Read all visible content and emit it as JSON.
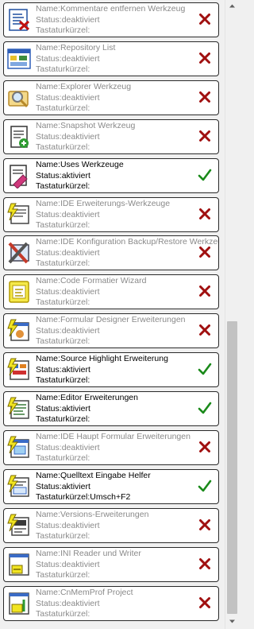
{
  "labels": {
    "name": "Name:",
    "status": "Status:",
    "shortcut": "Tastaturkürzel:"
  },
  "items": [
    {
      "name": "Kommentare entfernen Werkzeug",
      "status": "deaktiviert",
      "shortcut": "",
      "active": false,
      "icon": "comment-remove-icon"
    },
    {
      "name": "Repository List",
      "status": "deaktiviert",
      "shortcut": "",
      "active": false,
      "icon": "repository-list-icon"
    },
    {
      "name": "Explorer Werkzeug",
      "status": "deaktiviert",
      "shortcut": "",
      "active": false,
      "icon": "explorer-icon"
    },
    {
      "name": "Snapshot Werkzeug",
      "status": "deaktiviert",
      "shortcut": "",
      "active": false,
      "icon": "snapshot-icon"
    },
    {
      "name": "Uses Werkzeuge",
      "status": "aktiviert",
      "shortcut": "",
      "active": true,
      "icon": "uses-icon"
    },
    {
      "name": "IDE Erweiterungs-Werkzeuge",
      "status": "deaktiviert",
      "shortcut": "",
      "active": false,
      "icon": "ide-enhancement-icon"
    },
    {
      "name": "IDE Konfiguration Backup/Restore Werkzeug",
      "status": "deaktiviert",
      "shortcut": "",
      "active": false,
      "icon": "backup-restore-icon"
    },
    {
      "name": "Code Formatier Wizard",
      "status": "deaktiviert",
      "shortcut": "",
      "active": false,
      "icon": "code-formatter-icon"
    },
    {
      "name": "Formular Designer Erweiterungen",
      "status": "deaktiviert",
      "shortcut": "",
      "active": false,
      "icon": "form-designer-icon"
    },
    {
      "name": "Source Highlight Erweiterung",
      "status": "aktiviert",
      "shortcut": "",
      "active": true,
      "icon": "source-highlight-icon"
    },
    {
      "name": "Editor Erweiterungen",
      "status": "aktiviert",
      "shortcut": "",
      "active": true,
      "icon": "editor-enhancement-icon"
    },
    {
      "name": "IDE Haupt Formular Erweiterungen",
      "status": "deaktiviert",
      "shortcut": "",
      "active": false,
      "icon": "main-form-icon"
    },
    {
      "name": "Quelltext Eingabe Helfer",
      "status": "aktiviert",
      "shortcut": "Umsch+F2",
      "active": true,
      "icon": "input-helper-icon"
    },
    {
      "name": "Versions-Erweiterungen",
      "status": "deaktiviert",
      "shortcut": "",
      "active": false,
      "icon": "version-icon"
    },
    {
      "name": "INI Reader und Writer",
      "status": "deaktiviert",
      "shortcut": "",
      "active": false,
      "icon": "ini-reader-icon"
    },
    {
      "name": "CnMemProf Project",
      "status": "deaktiviert",
      "shortcut": "",
      "active": false,
      "icon": "memprof-icon"
    }
  ],
  "colors": {
    "enabled_check": "#1a8a1a",
    "disabled_cross": "#a01010"
  }
}
